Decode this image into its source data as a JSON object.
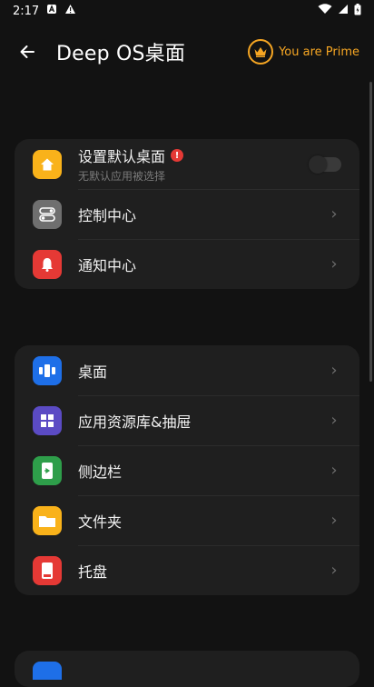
{
  "status_bar": {
    "time": "2:17"
  },
  "toolbar": {
    "title": "Deep OS桌面",
    "prime_label": "You are Prime"
  },
  "section1": {
    "items": [
      {
        "label": "设置默认桌面",
        "sub": "无默认应用被选择",
        "icon": "home-icon",
        "color": "#f9b21a",
        "toggle_on": false
      },
      {
        "label": "控制中心",
        "icon": "toggles-icon",
        "color": "#6f6f6f"
      },
      {
        "label": "通知中心",
        "icon": "bell-icon",
        "color": "#e53935"
      }
    ]
  },
  "section2": {
    "items": [
      {
        "label": "桌面",
        "icon": "desktop-icon",
        "color": "#1e6fe8"
      },
      {
        "label": "应用资源库&抽屉",
        "icon": "app-library-icon",
        "color": "#5b4bc4"
      },
      {
        "label": "侧边栏",
        "icon": "sidebar-icon",
        "color": "#2e9e4a"
      },
      {
        "label": "文件夹",
        "icon": "folder-icon",
        "color": "#f9b21a"
      },
      {
        "label": "托盘",
        "icon": "dock-icon",
        "color": "#e53935"
      }
    ]
  },
  "colors": {
    "accent": "#f6a623",
    "background": "#121212",
    "card": "#1f1f1f"
  }
}
